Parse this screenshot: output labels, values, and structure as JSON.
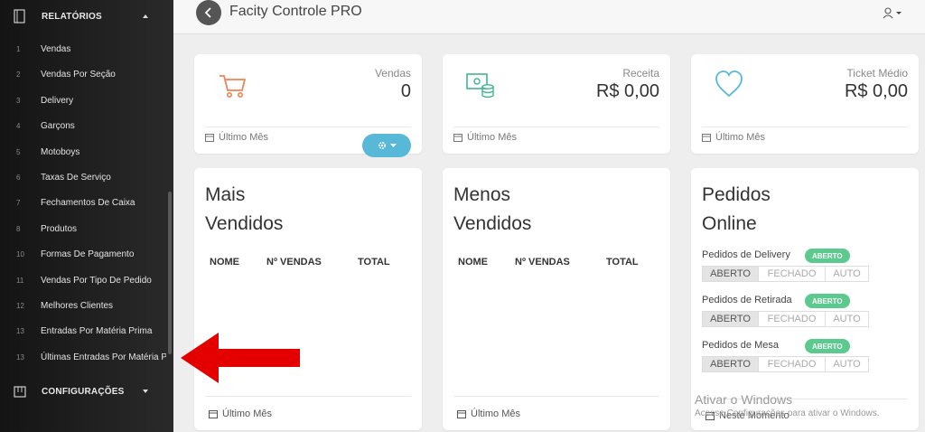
{
  "sidebar": {
    "reports_label": "RELATÓRIOS",
    "settings_label": "CONFIGURAÇÕES",
    "items": [
      {
        "num": "1",
        "label": "Vendas"
      },
      {
        "num": "2",
        "label": "Vendas Por Seção"
      },
      {
        "num": "3",
        "label": "Delivery"
      },
      {
        "num": "4",
        "label": "Garçons"
      },
      {
        "num": "5",
        "label": "Motoboys"
      },
      {
        "num": "6",
        "label": "Taxas De Serviço"
      },
      {
        "num": "7",
        "label": "Fechamentos De Caixa"
      },
      {
        "num": "8",
        "label": "Produtos"
      },
      {
        "num": "10",
        "label": "Formas De Pagamento"
      },
      {
        "num": "11",
        "label": "Vendas Por Tipo De Pedido"
      },
      {
        "num": "12",
        "label": "Melhores Clientes"
      },
      {
        "num": "13",
        "label": "Entradas Por Matéria Prima"
      },
      {
        "num": "13",
        "label": "Últimas Entradas Por Matéria Prima"
      }
    ]
  },
  "header": {
    "title": "Facity Controle PRO"
  },
  "stats": {
    "vendas": {
      "label": "Vendas",
      "value": "0",
      "footer": "Último Mês"
    },
    "receita": {
      "label": "Receita",
      "value": "R$ 0,00",
      "footer": "Último Mês"
    },
    "ticket": {
      "label": "Ticket Médio",
      "value": "R$ 0,00",
      "footer": "Último Mês"
    }
  },
  "mais_vendidos": {
    "title_line1": "Mais",
    "title_line2": "Vendidos",
    "columns": [
      "NOME",
      "Nº VENDAS",
      "TOTAL"
    ],
    "footer": "Último Mês"
  },
  "menos_vendidos": {
    "title_line1": "Menos",
    "title_line2": "Vendidos",
    "columns": [
      "NOME",
      "Nº VENDAS",
      "TOTAL"
    ],
    "footer": "Último Mês"
  },
  "pedidos_online": {
    "title_line1": "Pedidos",
    "title_line2": "Online",
    "rows": [
      {
        "label": "Pedidos de Delivery",
        "badge": "ABERTO"
      },
      {
        "label": "Pedidos de Retirada",
        "badge": "ABERTO"
      },
      {
        "label": "Pedidos de Mesa",
        "badge": "ABERTO"
      }
    ],
    "options": [
      "ABERTO",
      "FECHADO",
      "AUTO"
    ],
    "footer": "Neste Momento"
  },
  "watermark": {
    "line1": "Ativar o Windows",
    "line2": "Acesse Configurações para ativar o Windows."
  },
  "colors": {
    "accent_orange": "#ef8354",
    "accent_green": "#5cc98f",
    "accent_cyan": "#58b8d8",
    "arrow_red": "#e50000"
  }
}
